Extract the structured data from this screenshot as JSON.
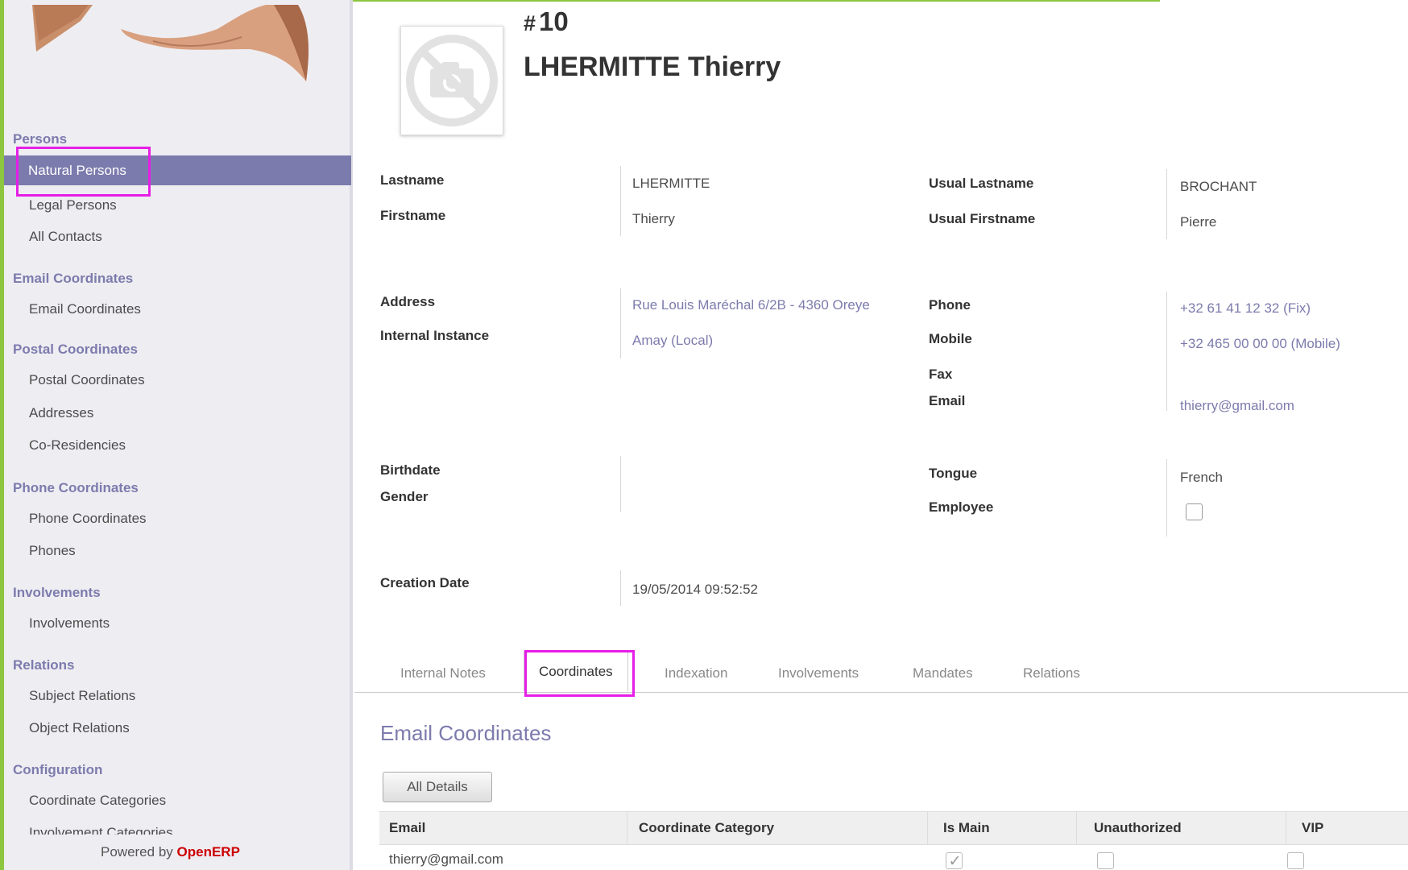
{
  "sidebar": {
    "sections": [
      {
        "title": "Persons",
        "items": [
          "Natural Persons",
          "Legal Persons",
          "All Contacts"
        ]
      },
      {
        "title": "Email Coordinates",
        "items": [
          "Email Coordinates"
        ]
      },
      {
        "title": "Postal Coordinates",
        "items": [
          "Postal Coordinates",
          "Addresses",
          "Co-Residencies"
        ]
      },
      {
        "title": "Phone Coordinates",
        "items": [
          "Phone Coordinates",
          "Phones"
        ]
      },
      {
        "title": "Involvements",
        "items": [
          "Involvements"
        ]
      },
      {
        "title": "Relations",
        "items": [
          "Subject Relations",
          "Object Relations"
        ]
      },
      {
        "title": "Configuration",
        "items": [
          "Coordinate Categories",
          "Involvement Categories"
        ]
      }
    ],
    "powered_by": "Powered by",
    "brand": "OpenERP"
  },
  "record": {
    "hash": "#",
    "number": "10",
    "name": "LHERMITTE Thierry"
  },
  "fields": {
    "lastname_label": "Lastname",
    "lastname": "LHERMITTE",
    "firstname_label": "Firstname",
    "firstname": "Thierry",
    "usual_lastname_label": "Usual Lastname",
    "usual_lastname": "BROCHANT",
    "usual_firstname_label": "Usual Firstname",
    "usual_firstname": "Pierre",
    "address_label": "Address",
    "address": "Rue Louis Maréchal 6/2B - 4360 Oreye",
    "internal_instance_label": "Internal Instance",
    "internal_instance": "Amay (Local)",
    "phone_label": "Phone",
    "phone": "+32 61 41 12 32 (Fix)",
    "mobile_label": "Mobile",
    "mobile": "+32 465 00 00 00 (Mobile)",
    "fax_label": "Fax",
    "email_label": "Email",
    "email": "thierry@gmail.com",
    "birthdate_label": "Birthdate",
    "gender_label": "Gender",
    "tongue_label": "Tongue",
    "tongue": "French",
    "employee_label": "Employee",
    "employee_checked": false,
    "creation_date_label": "Creation Date",
    "creation_date": "19/05/2014 09:52:52"
  },
  "tabs": [
    "Internal Notes",
    "Coordinates",
    "Indexation",
    "Involvements",
    "Mandates",
    "Relations"
  ],
  "active_tab": "Coordinates",
  "email_section": {
    "title": "Email Coordinates",
    "button": "All Details",
    "columns": [
      "Email",
      "Coordinate Category",
      "Is Main",
      "Unauthorized",
      "VIP"
    ],
    "rows": [
      {
        "email": "thierry@gmail.com",
        "category": "",
        "is_main": true,
        "unauthorized": false,
        "vip": false
      }
    ]
  },
  "colors": {
    "accent": "#7c7bad",
    "highlight": "#e61ee6",
    "top_bar": "#8dc63f",
    "brand": "#cc0000"
  }
}
